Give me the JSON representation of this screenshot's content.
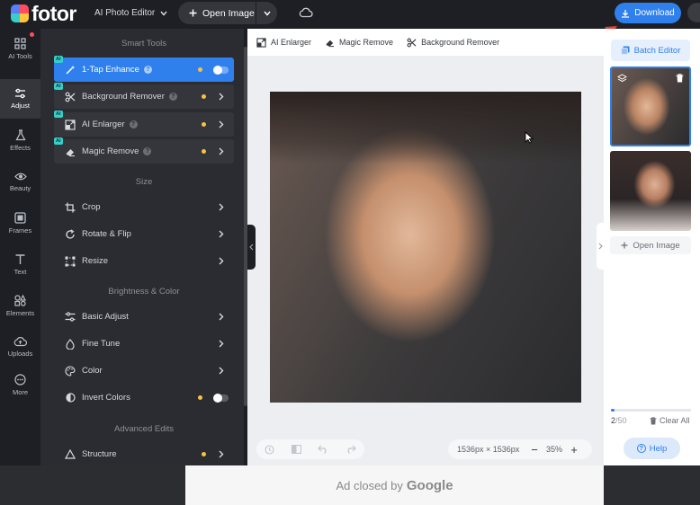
{
  "brand": {
    "name": "fotor"
  },
  "topbar": {
    "app_menu": "AI Photo Editor",
    "open_image": "Open Image",
    "download": "Download"
  },
  "rail": {
    "items": [
      {
        "label": "AI Tools",
        "icon": "grid-icon"
      },
      {
        "label": "Adjust",
        "icon": "sliders-icon"
      },
      {
        "label": "Effects",
        "icon": "flask-icon"
      },
      {
        "label": "Beauty",
        "icon": "eye-icon"
      },
      {
        "label": "Frames",
        "icon": "frame-icon"
      },
      {
        "label": "Text",
        "icon": "text-icon"
      },
      {
        "label": "Elements",
        "icon": "shapes-icon"
      },
      {
        "label": "Uploads",
        "icon": "cloud-upload-icon"
      },
      {
        "label": "More",
        "icon": "more-icon"
      }
    ]
  },
  "panel": {
    "smart_tools_title": "Smart Tools",
    "ai_badge": "AI",
    "smart_tools": [
      {
        "label": "1-Tap Enhance"
      },
      {
        "label": "Background Remover"
      },
      {
        "label": "AI Enlarger"
      },
      {
        "label": "Magic Remove"
      }
    ],
    "size_title": "Size",
    "size_tools": [
      {
        "label": "Crop"
      },
      {
        "label": "Rotate & Flip"
      },
      {
        "label": "Resize"
      }
    ],
    "brightness_title": "Brightness & Color",
    "brightness_tools": [
      {
        "label": "Basic Adjust"
      },
      {
        "label": "Fine Tune"
      },
      {
        "label": "Color"
      },
      {
        "label": "Invert Colors"
      }
    ],
    "advanced_title": "Advanced Edits",
    "advanced_tools": [
      {
        "label": "Structure"
      }
    ]
  },
  "canvas_toolbar": {
    "items": [
      "AI Enlarger",
      "Magic Remove",
      "Background Remover"
    ]
  },
  "canvas": {
    "dimensions": "1536px × 1536px",
    "zoom": "35%"
  },
  "right_panel": {
    "batch_editor": "Batch Editor",
    "open_image": "Open Image",
    "count_current": "2",
    "count_total": "/50",
    "count_progress": 0.04,
    "clear_all": "Clear All",
    "help": "Help"
  },
  "ad": {
    "text": "Ad closed by",
    "brand": "Google"
  },
  "colors": {
    "accent": "#2f80ed",
    "dark_bg": "#1d1f24",
    "panel_bg": "#2a2c31",
    "toggle_dot": "#f5c243",
    "annotation_arrow": "#e0413a"
  }
}
